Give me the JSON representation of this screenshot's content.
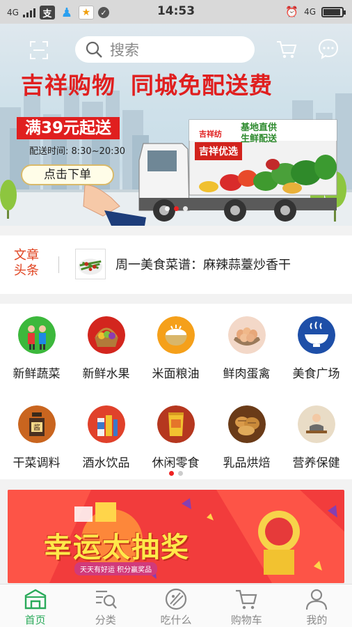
{
  "status_bar": {
    "network": "4G",
    "time": "14:53",
    "right_network": "4G",
    "apps": [
      {
        "icon": "alipay-icon",
        "glyph": "支"
      },
      {
        "icon": "qq-icon",
        "glyph": "♟"
      },
      {
        "icon": "star-app-icon",
        "glyph": "★"
      },
      {
        "icon": "check-icon",
        "glyph": "✓"
      }
    ]
  },
  "header": {
    "search_placeholder": "搜索",
    "icons": [
      "scan-icon",
      "search-icon",
      "cart-icon",
      "message-icon"
    ]
  },
  "hero": {
    "headline_left": "吉祥购物",
    "headline_right": "同城免配送费",
    "min_order": "满39元起送",
    "delivery_time": "配送时间:  8:30~20:30",
    "order_button": "点击下单",
    "truck_brand": "吉祥纺",
    "truck_tag": "吉祥优选",
    "truck_slogan": "基地直供生鲜配送",
    "colors": {
      "headline": "#e01f1f",
      "truck_tag": "#d2231d",
      "slogan": "#2d8a2d"
    }
  },
  "news": {
    "tag": "文章头条",
    "headline": "周一美食菜谱：麻辣蒜薹炒香干"
  },
  "categories": [
    {
      "label": "新鲜蔬菜",
      "icon": "vegetables-icon",
      "color": "#3cb83c"
    },
    {
      "label": "新鲜水果",
      "icon": "fruit-basket-icon",
      "color": "#d3261e"
    },
    {
      "label": "米面粮油",
      "icon": "rice-bowl-icon",
      "color": "#f5a01a"
    },
    {
      "label": "鲜肉蛋禽",
      "icon": "eggs-icon",
      "color": "#f3d8c8"
    },
    {
      "label": "美食广场",
      "icon": "hot-dish-icon",
      "color": "#1e4fa8"
    },
    {
      "label": "干菜调料",
      "icon": "sauce-jar-icon",
      "color": "#c9651f"
    },
    {
      "label": "酒水饮品",
      "icon": "drinks-icon",
      "color": "#e0412b"
    },
    {
      "label": "休闲零食",
      "icon": "snack-bag-icon",
      "color": "#b5371f"
    },
    {
      "label": "乳品烘焙",
      "icon": "bread-icon",
      "color": "#6a3b18"
    },
    {
      "label": "营养保健",
      "icon": "health-icon",
      "color": "#e9dcc6"
    }
  ],
  "promo": {
    "title": "幸运太抽奖",
    "subtitle": "天天有好运  积分赢奖品",
    "colors": {
      "bg": "#f23c3c",
      "title": "#ffe94a"
    }
  },
  "tabbar": {
    "active": 0,
    "tabs": [
      {
        "label": "首页",
        "icon": "home-icon"
      },
      {
        "label": "分类",
        "icon": "category-search-icon"
      },
      {
        "label": "吃什么",
        "icon": "food-icon"
      },
      {
        "label": "购物车",
        "icon": "cart-icon"
      },
      {
        "label": "我的",
        "icon": "user-icon"
      }
    ],
    "colors": {
      "active": "#2aaa5a",
      "inactive": "#8a8a8a"
    }
  }
}
